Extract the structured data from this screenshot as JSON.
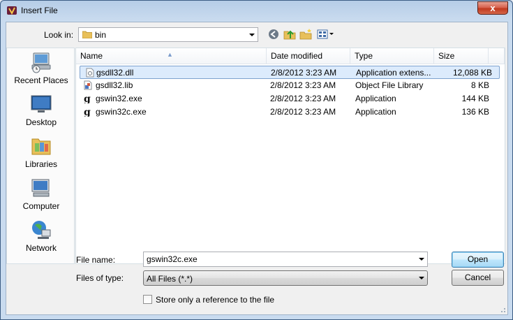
{
  "window": {
    "title": "Insert File",
    "close_label": "x"
  },
  "lookin": {
    "label": "Look in:",
    "value": "bin"
  },
  "places": [
    {
      "label": "Recent Places",
      "icon": "recent-places-icon"
    },
    {
      "label": "Desktop",
      "icon": "desktop-icon"
    },
    {
      "label": "Libraries",
      "icon": "libraries-icon"
    },
    {
      "label": "Computer",
      "icon": "computer-icon"
    },
    {
      "label": "Network",
      "icon": "network-icon"
    }
  ],
  "columns": [
    "Name",
    "Date modified",
    "Type",
    "Size"
  ],
  "files": [
    {
      "name": "gsdll32.dll",
      "date": "2/8/2012 3:23 AM",
      "type": "Application extens...",
      "size": "12,088 KB",
      "icon": "dll-file-icon",
      "selected": true
    },
    {
      "name": "gsdll32.lib",
      "date": "2/8/2012 3:23 AM",
      "type": "Object File Library",
      "size": "8 KB",
      "icon": "lib-file-icon",
      "selected": false
    },
    {
      "name": "gswin32.exe",
      "date": "2/8/2012 3:23 AM",
      "type": "Application",
      "size": "144 KB",
      "icon": "ghostscript-exe-icon",
      "selected": false
    },
    {
      "name": "gswin32c.exe",
      "date": "2/8/2012 3:23 AM",
      "type": "Application",
      "size": "136 KB",
      "icon": "ghostscript-exe-icon",
      "selected": false
    }
  ],
  "filename": {
    "label": "File name:",
    "value": "gswin32c.exe"
  },
  "filetype": {
    "label": "Files of type:",
    "value": "All Files (*.*)"
  },
  "buttons": {
    "open": "Open",
    "cancel": "Cancel"
  },
  "reference": {
    "label": "Store only a reference to the file",
    "checked": false
  },
  "colors": {
    "selection_bg": "#dcebfc",
    "selection_border": "#7da2ce",
    "title_bg": "#c9dbef",
    "close_red": "#c0391f"
  }
}
